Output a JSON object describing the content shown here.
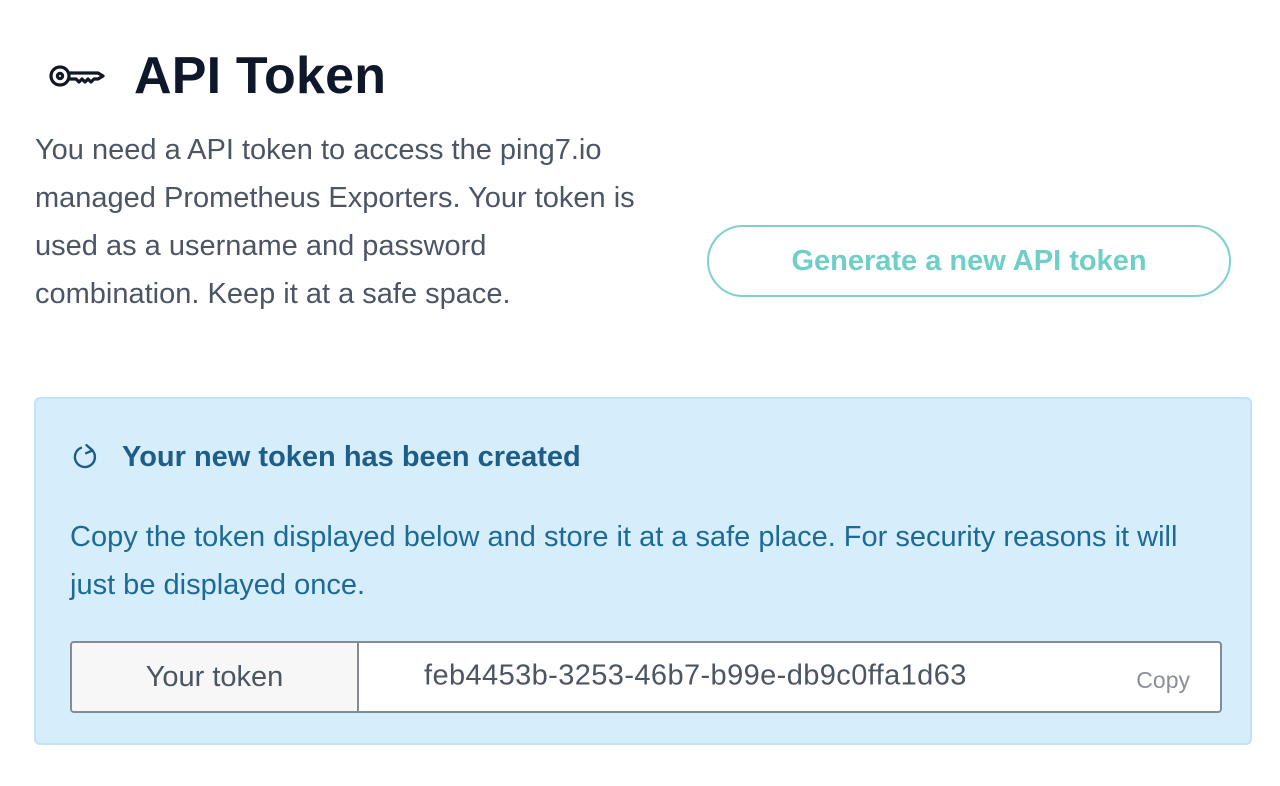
{
  "header": {
    "title": "API Token",
    "icon": "key-icon"
  },
  "intro": {
    "text": "You need a API token to access the ping7.io managed Prometheus Exporters. Your token is used as a username and password combination. Keep it at a safe space."
  },
  "actions": {
    "generate_label": "Generate a new API token"
  },
  "alert": {
    "icon": "refresh-icon",
    "title": "Your new token has been created",
    "body": "Copy the token displayed below and store it at a safe place. For security reasons it will just be displayed once."
  },
  "token": {
    "label": "Your token",
    "value": "feb4453b-3253-46b7-b99e-db9c0ffa1d63",
    "copy_label": "Copy"
  },
  "colors": {
    "title": "#0f172a",
    "accent_teal": "#6fcfc7",
    "alert_background": "#d6edfb",
    "alert_text": "#1e6a96"
  }
}
